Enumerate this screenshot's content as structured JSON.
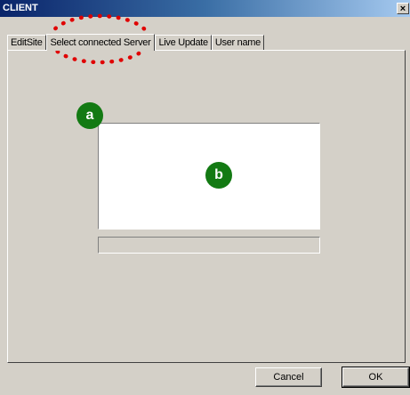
{
  "window": {
    "title": "CLIENT",
    "close_glyph": "×"
  },
  "tabs": [
    {
      "label": "EditSite",
      "active": false
    },
    {
      "label": "Select connected Server",
      "active": true
    },
    {
      "label": "Live Update",
      "active": false
    },
    {
      "label": "User name",
      "active": false
    }
  ],
  "markers": {
    "a": "a",
    "b": "b"
  },
  "buttons": {
    "cancel": "Cancel",
    "ok": "OK"
  },
  "colors": {
    "titlebar_start": "#0a246a",
    "marker_green": "#137a13",
    "annotation_red": "#e00000"
  }
}
